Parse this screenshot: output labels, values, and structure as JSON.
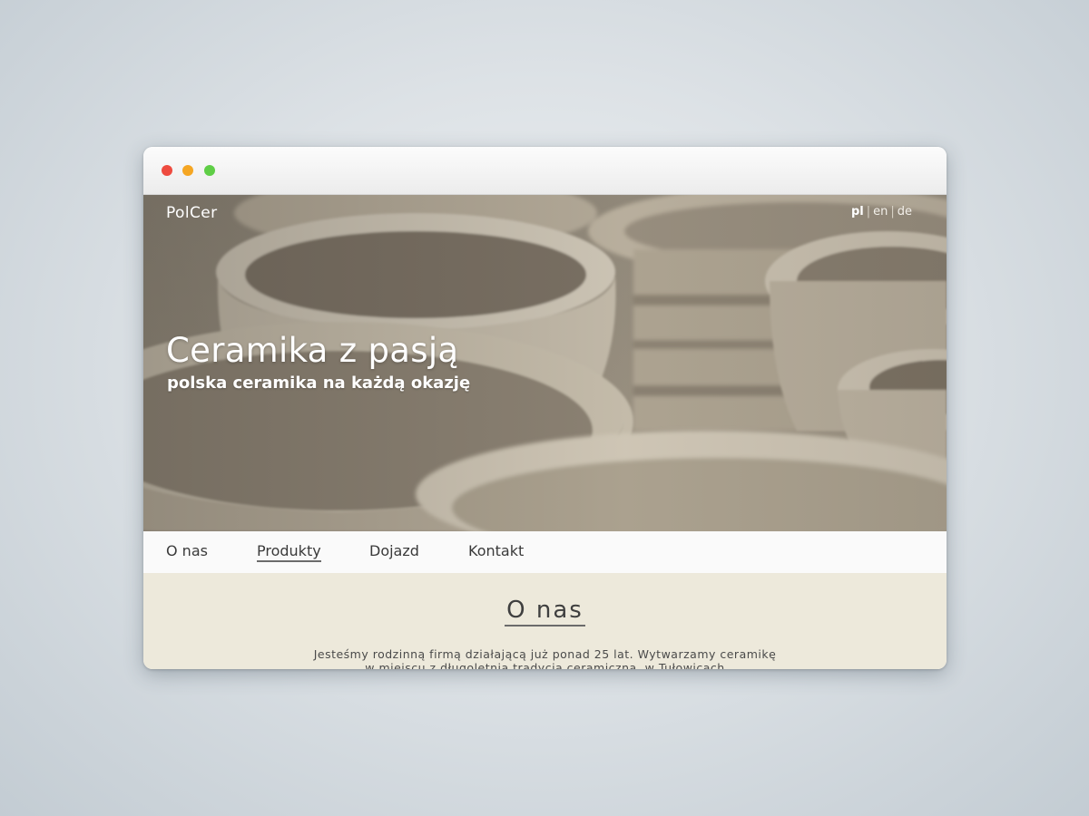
{
  "site": {
    "logo": "PolCer",
    "languages": [
      {
        "code": "pl",
        "active": true
      },
      {
        "code": "en",
        "active": false
      },
      {
        "code": "de",
        "active": false
      }
    ],
    "language_separator": "|"
  },
  "hero": {
    "title": "Ceramika z pasją",
    "subtitle": "polska ceramika na każdą okazję",
    "image_subject": "unglazed clay pottery bowls"
  },
  "nav": {
    "items": [
      {
        "label": "O nas",
        "current": false
      },
      {
        "label": "Produkty",
        "current": true
      },
      {
        "label": "Dojazd",
        "current": false
      },
      {
        "label": "Kontakt",
        "current": false
      }
    ]
  },
  "about": {
    "title": "O nas",
    "text": "Jesteśmy rodzinną firmą działającą już ponad 25 lat. Wytwarzamy ceramikę w miejscu z długoletnią tradycją ceramiczną, w Tułowicach"
  },
  "colors": {
    "window_controls": [
      "#ee4b3f",
      "#f5a623",
      "#5fce46"
    ],
    "content_background": "#ede9db",
    "nav_background": "#fafafa"
  }
}
